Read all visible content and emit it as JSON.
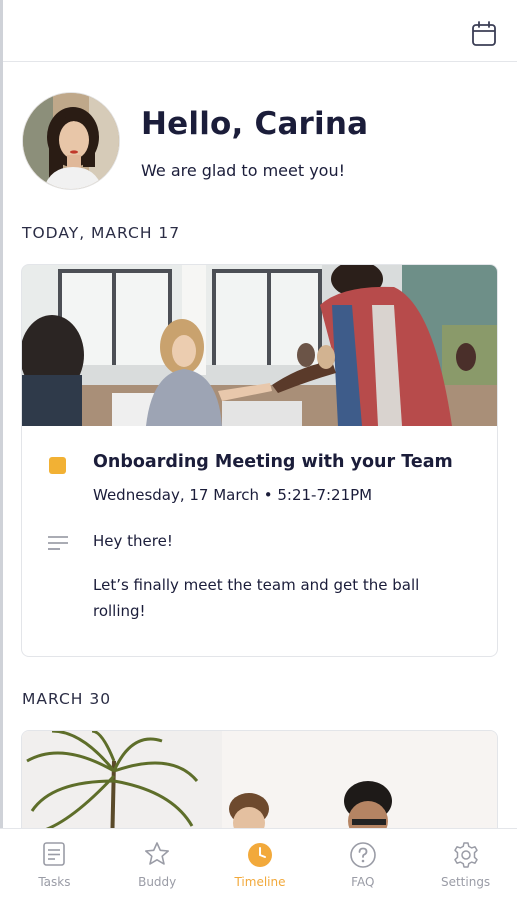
{
  "profile": {
    "greeting": "Hello, Carina",
    "subtitle": "We are glad to meet you!"
  },
  "sections": [
    {
      "title": "TODAY, MARCH 17"
    },
    {
      "title": "MARCH 30"
    }
  ],
  "event": {
    "title": "Onboarding Meeting with your Team",
    "datetime": "Wednesday, 17 March • 5:21-7:21PM",
    "description_greeting": "Hey there!",
    "description_body": "Let’s finally meet the team and get the ball rolling!",
    "color": "#f2b134"
  },
  "tabs": [
    {
      "label": "Tasks",
      "icon": "document-icon",
      "active": false
    },
    {
      "label": "Buddy",
      "icon": "star-icon",
      "active": false
    },
    {
      "label": "Timeline",
      "icon": "clock-icon",
      "active": true
    },
    {
      "label": "FAQ",
      "icon": "help-icon",
      "active": false
    },
    {
      "label": "Settings",
      "icon": "gear-icon",
      "active": false
    }
  ],
  "colors": {
    "accent": "#f2a93b",
    "text": "#1b1d3a",
    "inactive": "#9a9ca6"
  }
}
